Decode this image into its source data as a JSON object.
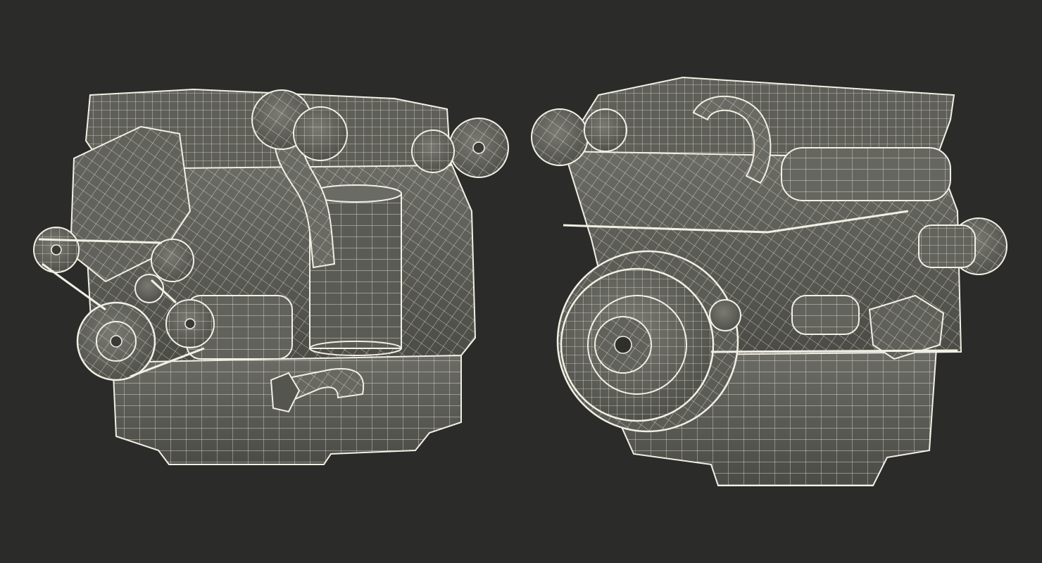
{
  "scene": {
    "background_color": "#2b2b29",
    "wire_color": "#f2efe4",
    "surface_color": "#5a5a55",
    "views": [
      {
        "name": "engine-front-three-quarter-view"
      },
      {
        "name": "engine-rear-three-quarter-view"
      }
    ]
  }
}
